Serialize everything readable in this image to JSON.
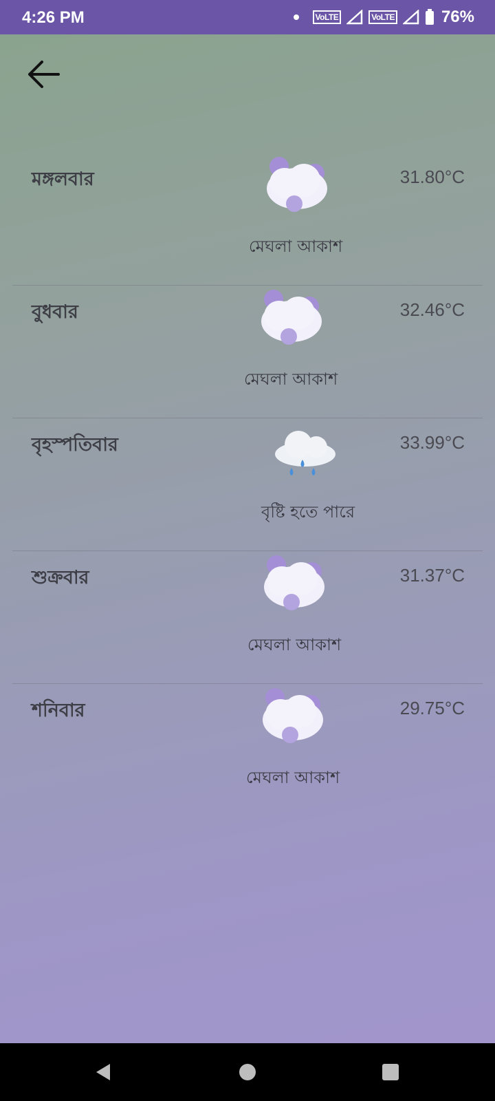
{
  "status_bar": {
    "time": "4:26 PM",
    "volte1": "VoLTE",
    "volte2": "VoLTE",
    "battery": "76%"
  },
  "forecast": [
    {
      "day": "মঙ্গলবার",
      "description": "মেঘলা আকাশ",
      "temperature": "31.80°C",
      "icon": "cloudy-icon"
    },
    {
      "day": "বুধবার",
      "description": "মেঘলা আকাশ",
      "temperature": "32.46°C",
      "icon": "cloudy-icon"
    },
    {
      "day": "বৃহস্পতিবার",
      "description": "বৃষ্টি হতে পারে",
      "temperature": "33.99°C",
      "icon": "rain-cloud-icon"
    },
    {
      "day": "শুক্রবার",
      "description": "মেঘলা আকাশ",
      "temperature": "31.37°C",
      "icon": "cloudy-icon"
    },
    {
      "day": "শনিবার",
      "description": "মেঘলা আকাশ",
      "temperature": "29.75°C",
      "icon": "cloudy-icon"
    }
  ],
  "colors": {
    "status_bar": "#6a55a6",
    "gradient_top": "#8aa38e",
    "gradient_bottom": "#a295cc",
    "cloud_accent": "#a48fd6",
    "rain_drop": "#4a90d9"
  }
}
